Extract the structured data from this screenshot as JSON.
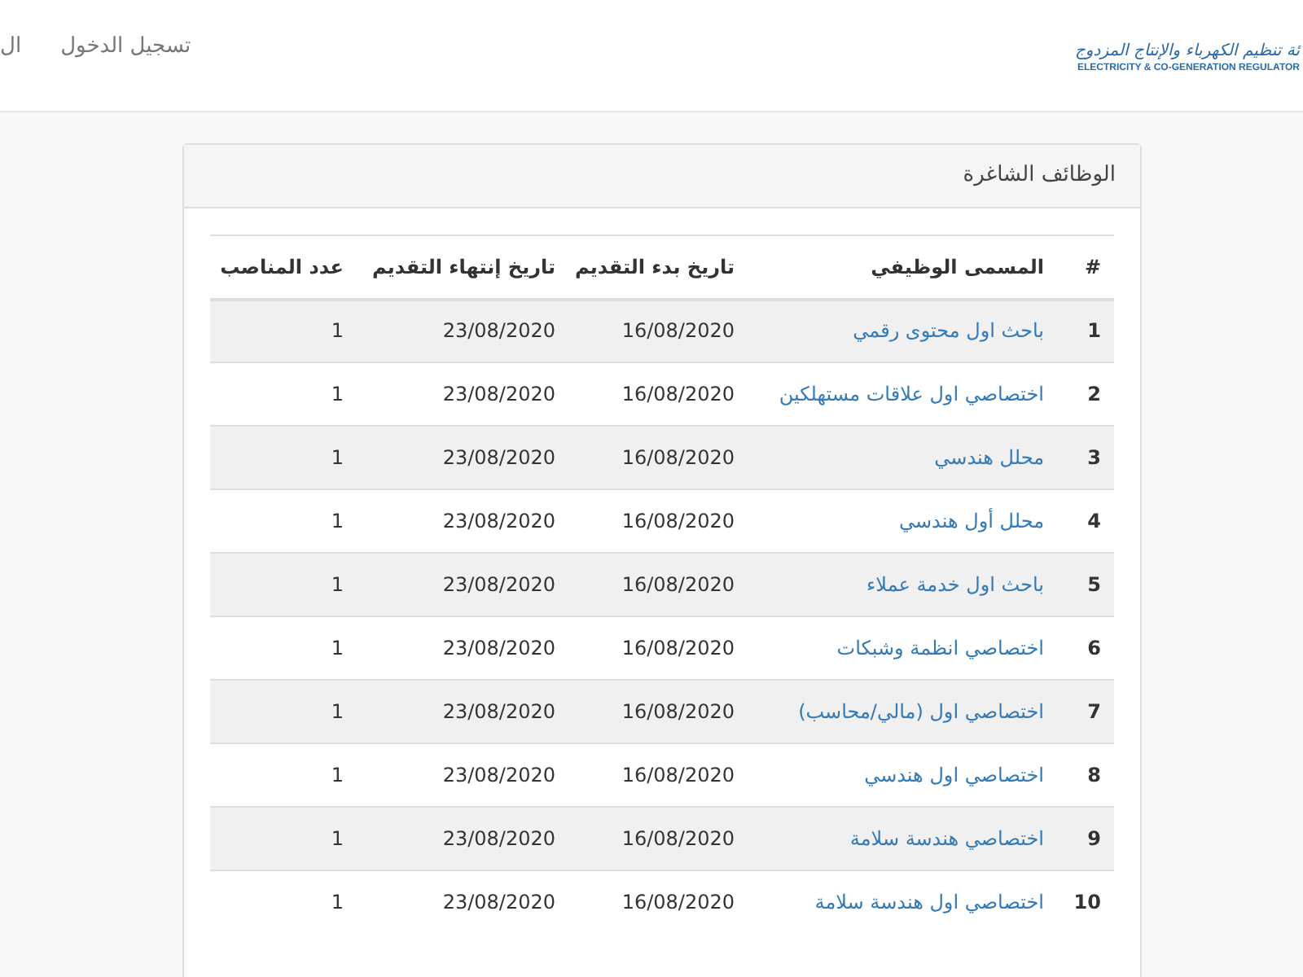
{
  "header": {
    "logo": {
      "arabic": "ئة تنظيم الكهرباء والإنتاج المزدوج",
      "english": "ELECTRICITY & CO-GENERATION REGULATOR"
    },
    "nav": [
      {
        "label": "تسجيل الدخول"
      },
      {
        "label": "ال"
      }
    ]
  },
  "panel": {
    "title": "الوظائف الشاغرة",
    "table": {
      "columns": [
        "#",
        "المسمى الوظيفي",
        "تاريخ بدء التقديم",
        "تاريخ إنتهاء التقديم",
        "عدد المناصب"
      ],
      "rows": [
        {
          "number": "1",
          "title": "باحث اول محتوى رقمي",
          "start": "16/08/2020",
          "end": "23/08/2020",
          "positions": "1"
        },
        {
          "number": "2",
          "title": "اختصاصي اول علاقات مستهلكين",
          "start": "16/08/2020",
          "end": "23/08/2020",
          "positions": "1"
        },
        {
          "number": "3",
          "title": "محلل هندسي",
          "start": "16/08/2020",
          "end": "23/08/2020",
          "positions": "1"
        },
        {
          "number": "4",
          "title": "محلل أول هندسي",
          "start": "16/08/2020",
          "end": "23/08/2020",
          "positions": "1"
        },
        {
          "number": "5",
          "title": "باحث اول خدمة عملاء",
          "start": "16/08/2020",
          "end": "23/08/2020",
          "positions": "1"
        },
        {
          "number": "6",
          "title": "اختصاصي انظمة وشبكات",
          "start": "16/08/2020",
          "end": "23/08/2020",
          "positions": "1"
        },
        {
          "number": "7",
          "title": "اختصاصي اول (مالي/محاسب)",
          "start": "16/08/2020",
          "end": "23/08/2020",
          "positions": "1"
        },
        {
          "number": "8",
          "title": "اختصاصي اول هندسي",
          "start": "16/08/2020",
          "end": "23/08/2020",
          "positions": "1"
        },
        {
          "number": "9",
          "title": "اختصاصي هندسة سلامة",
          "start": "16/08/2020",
          "end": "23/08/2020",
          "positions": "1"
        },
        {
          "number": "10",
          "title": "اختصاصي اول هندسة سلامة",
          "start": "16/08/2020",
          "end": "23/08/2020",
          "positions": "1"
        }
      ]
    }
  }
}
